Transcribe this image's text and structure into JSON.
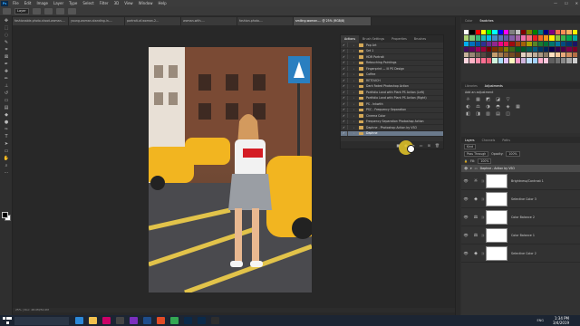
{
  "app": {
    "logo": "Ps"
  },
  "menu": [
    "File",
    "Edit",
    "Image",
    "Layer",
    "Type",
    "Select",
    "Filter",
    "3D",
    "View",
    "Window",
    "Help"
  ],
  "options": {
    "mode_value": "Layer"
  },
  "doc_tabs": [
    {
      "label": "fashionable-photo-shoot-woman-...",
      "active": false
    },
    {
      "label": "young-woman-standing-in-...",
      "active": false
    },
    {
      "label": "portrait-of-woman-2...",
      "active": false
    },
    {
      "label": "woman-with-...",
      "active": false
    },
    {
      "label": "fashion-photo-...",
      "active": false
    },
    {
      "label": "smiling-woman-... @ 25% (RGB/8)",
      "active": true
    }
  ],
  "status": {
    "text": "25% | Doc: 48.0M/52.0M"
  },
  "actions_panel": {
    "tabs": [
      "Actions",
      "Brush Settings",
      "Properties",
      "Brushes"
    ],
    "rows": [
      {
        "label": "Pop Art",
        "selected": false
      },
      {
        "label": "Set 1",
        "selected": false
      },
      {
        "label": "HDR Portrait",
        "selected": false
      },
      {
        "label": "Retouching Paintings",
        "selected": false
      },
      {
        "label": "Fingerprint — Ill PS Design",
        "selected": false
      },
      {
        "label": "Coffee",
        "selected": false
      },
      {
        "label": "RETOUCH",
        "selected": false
      },
      {
        "label": "Dark Faded Photoshop Action",
        "selected": false
      },
      {
        "label": "Portfolio Land with Plant PS Action (Left)",
        "selected": false
      },
      {
        "label": "Portfolio Land with Plant PS Action (Right)",
        "selected": false
      },
      {
        "label": "PS - Inkwith",
        "selected": false
      },
      {
        "label": "PSC - Frequency Separation",
        "selected": false
      },
      {
        "label": "Cinema Color",
        "selected": false
      },
      {
        "label": "Frequency Separation Photoshop Action",
        "selected": false
      },
      {
        "label": "Daphne - Photoshop Action by VSO",
        "selected": false
      },
      {
        "label": "Daphne",
        "selected": true
      }
    ]
  },
  "swatches_panel": {
    "tabs": [
      "Color",
      "Swatches"
    ],
    "colors": [
      "#ffffff",
      "#000000",
      "#ff0000",
      "#ffff00",
      "#00ff00",
      "#00ffff",
      "#0000ff",
      "#ff00ff",
      "#808080",
      "#c0c0c0",
      "#800000",
      "#808000",
      "#008000",
      "#008080",
      "#000080",
      "#800080",
      "#f26c4f",
      "#f68e56",
      "#fbaf5d",
      "#fff200",
      "#acd373",
      "#7cc576",
      "#3bb878",
      "#1abbb4",
      "#00bff3",
      "#438cca",
      "#5574b9",
      "#605ca8",
      "#855fa8",
      "#a763a8",
      "#f06ea9",
      "#f26d7d",
      "#ed1c24",
      "#f26522",
      "#f7941d",
      "#fff200",
      "#8dc63f",
      "#39b54a",
      "#00a651",
      "#00a99d",
      "#00aeef",
      "#0072bc",
      "#0054a6",
      "#2e3192",
      "#662d91",
      "#92278f",
      "#ec008c",
      "#ed145b",
      "#9e0b0f",
      "#a0410d",
      "#a36209",
      "#aba000",
      "#598527",
      "#1a7b30",
      "#007236",
      "#00746b",
      "#0076a3",
      "#004b80",
      "#003471",
      "#1b1464",
      "#440e62",
      "#630460",
      "#9e005d",
      "#9e0039",
      "#790000",
      "#7b2e00",
      "#7d4900",
      "#827b00",
      "#406618",
      "#005e20",
      "#005826",
      "#005952",
      "#005b7f",
      "#003663",
      "#002157",
      "#0d004c",
      "#32004b",
      "#4b0049",
      "#7b0046",
      "#7a0026",
      "#c7b299",
      "#998675",
      "#736357",
      "#534741",
      "#37302d",
      "#c69c6d",
      "#a67c52",
      "#8c6239",
      "#754c24",
      "#603913",
      "#e2d1c1",
      "#d4c4b0",
      "#bfae9a",
      "#a89882",
      "#8a7a66",
      "#ffe0c0",
      "#f5c89c",
      "#e8a97a",
      "#d08c5e",
      "#b56f45",
      "#ffd6e0",
      "#ffb3c6",
      "#ff8fab",
      "#fb6f92",
      "#e85d75",
      "#d0f4de",
      "#a9def9",
      "#e4c1f9",
      "#fcf6bd",
      "#ff99c8",
      "#cdb4db",
      "#bde0fe",
      "#a2d2ff",
      "#ffafcc",
      "#ffc8dd",
      "#5e5e5e",
      "#707070",
      "#8a8a8a",
      "#a8a8a8",
      "#cfcfcf"
    ]
  },
  "adjustments_panel": {
    "tabs": [
      "Libraries",
      "Adjustments"
    ],
    "label": "Add an adjustment",
    "row1": [
      "☼",
      "▦",
      "◩",
      "◪",
      "▽"
    ],
    "row2": [
      "◐",
      "⚖",
      "◑",
      "◓",
      "◈",
      "▦"
    ],
    "row3": [
      "◧",
      "◨",
      "▥",
      "▤",
      "◫"
    ]
  },
  "layers_panel": {
    "tabs": [
      "Layers",
      "Channels",
      "Paths"
    ],
    "filter_label": "Kind",
    "blend_mode": "Pass Through",
    "opacity_label": "Opacity:",
    "opacity_value": "100%",
    "fill_label": "Fill:",
    "fill_value": "100%",
    "group_name": "Daphne - Action by VSO",
    "layers": [
      {
        "name": "Brightness/Contrast 1",
        "icon": "☼"
      },
      {
        "name": "Selective Color 3",
        "icon": "◈"
      },
      {
        "name": "Color Balance 2",
        "icon": "⚖"
      },
      {
        "name": "Color Balance 1",
        "icon": "⚖"
      },
      {
        "name": "Selective Color 2",
        "icon": "◈"
      }
    ]
  },
  "taskbar": {
    "apps": [
      "#2b88d8",
      "#f2c14e",
      "#cc0066",
      "#444",
      "#7b2fbe",
      "#1e4d8c",
      "#e34c26",
      "#34a853",
      "#0b2a4a",
      "#0b2a4a",
      "#2d2d2d"
    ],
    "lang": "ENG",
    "time": "1:34 PM",
    "date": "3/4/2019"
  }
}
